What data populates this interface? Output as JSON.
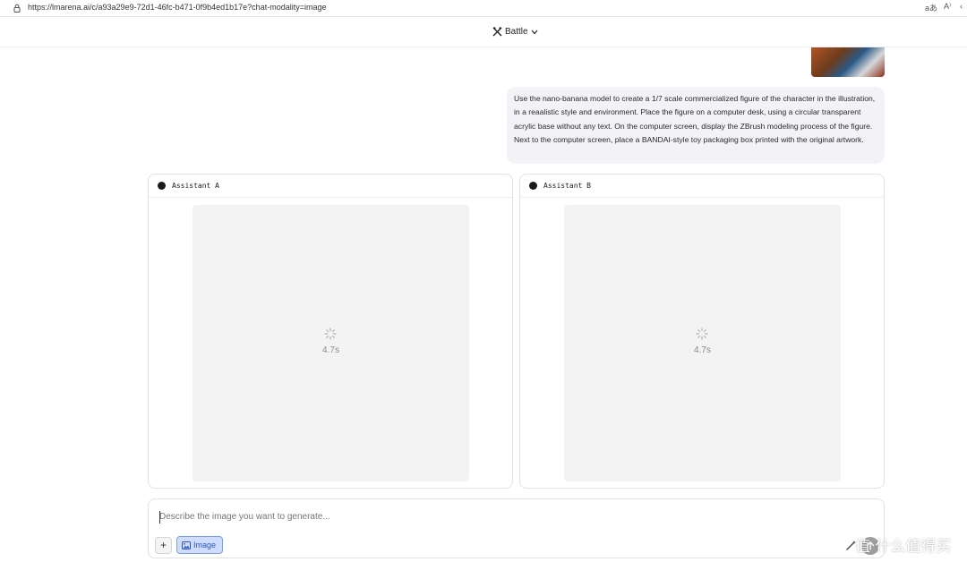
{
  "browser": {
    "url": "https://lmarena.ai/c/a93a29e9-72d1-46fc-b471-0f9b4ed1b17e?chat-modality=image",
    "icons": [
      "lock-icon",
      "read-aloud-icon",
      "text-size-icon",
      "back-icon"
    ]
  },
  "header": {
    "mode_label": "Battle",
    "icons": [
      "battle-icon",
      "chevron-down-icon"
    ]
  },
  "conversation": {
    "user_prompt": "Use the nano-banana model to create a 1/7 scale commercialized figure of the character in the illustration, in a reaalistic style and environment. Place the figure on a computer desk, using a circular transparent acrylic base without any text. On the computer screen, display the ZBrush modeling process of the figure. Next to the computer screen, place a BANDAI-style toy packaging box printed with the original artwork."
  },
  "assistants": [
    {
      "name": "Assistant A",
      "status_time": "4.7s"
    },
    {
      "name": "Assistant B",
      "status_time": "4.7s"
    }
  ],
  "composer": {
    "placeholder": "Describe the image you want to generate...",
    "add_label": "+",
    "image_mode_label": "Image",
    "icons": [
      "plus-icon",
      "image-icon",
      "magic-wand-icon",
      "send-icon"
    ]
  },
  "overlay": {
    "watermark": "值 什么值得买"
  },
  "colors": {
    "accent": "#2d56c4",
    "accent_bg": "#cfdcfb",
    "bubble_bg": "#f3f3f7",
    "canvas_bg": "#f3f3f3"
  }
}
